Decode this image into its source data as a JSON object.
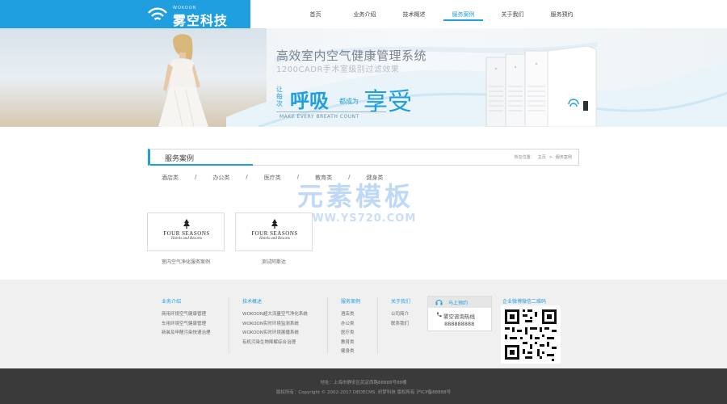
{
  "brand": {
    "sub": "WOKOON",
    "name": "雾空科技",
    "color": "#1f9fe0"
  },
  "nav": {
    "items": [
      "首页",
      "业务介绍",
      "技术概述",
      "服务案例",
      "关于我们",
      "服务预约"
    ],
    "active_index": 3
  },
  "banner": {
    "title": "高效室内空气健康管理系统",
    "subtitle": "1200CADR手术室级别过滤效果",
    "slogan_small": "让每次",
    "slogan_breath": "呼吸",
    "slogan_become": "都成为",
    "slogan_enjoy": "享受",
    "slogan_en": "MAKE EVERY BREATH COUNT"
  },
  "section": {
    "title": "服务案例",
    "breadcrumb_label": "所在位置：",
    "breadcrumb_home": "主页",
    "breadcrumb_sep": ">",
    "breadcrumb_current": "服务案例"
  },
  "categories": [
    "酒店类",
    "办公类",
    "医疗类",
    "教育类",
    "健身类"
  ],
  "category_separator": "/",
  "watermark": {
    "cn": "元素模板",
    "en": "WWW.YS720.COM"
  },
  "cases": [
    {
      "logo_name": "FOUR SEASONS",
      "logo_sub": "Hotels and Resorts",
      "caption": "室内空气净化服务案例"
    },
    {
      "logo_name": "FOUR SEASONS",
      "logo_sub": "Hotels and Resorts",
      "caption": "测试阿斯达"
    }
  ],
  "footer": {
    "columns": [
      {
        "title": "业务介绍",
        "items": [
          "商用环境空气健康管理",
          "车用环境空气健康管理",
          "新装及甲醛污染快速治理"
        ]
      },
      {
        "title": "技术概述",
        "items": [
          "WOKOON超大流量空气净化系统",
          "WOKOON实时环境监测系统",
          "WOKOON实时环境展播系统",
          "有机污染生物降解综合治理"
        ]
      },
      {
        "title": "服务案例",
        "items": [
          "酒店类",
          "办公类",
          "医疗类",
          "教育类",
          "健身类"
        ]
      },
      {
        "title": "关于我们",
        "items": [
          "公司简介",
          "联系我们"
        ]
      }
    ],
    "hotline": {
      "header": "马上预约",
      "label": "雾空咨询热线",
      "number": "888888888"
    },
    "qr_title": "企业微博微信二维码"
  },
  "bottom": {
    "address": "地址：上海市静安区武定西路88888号88楼",
    "copyright": "版权所有：Copyright © 2002-2017 DEDECMS. 织梦科技 版权所有 沪ICP备88888号"
  }
}
